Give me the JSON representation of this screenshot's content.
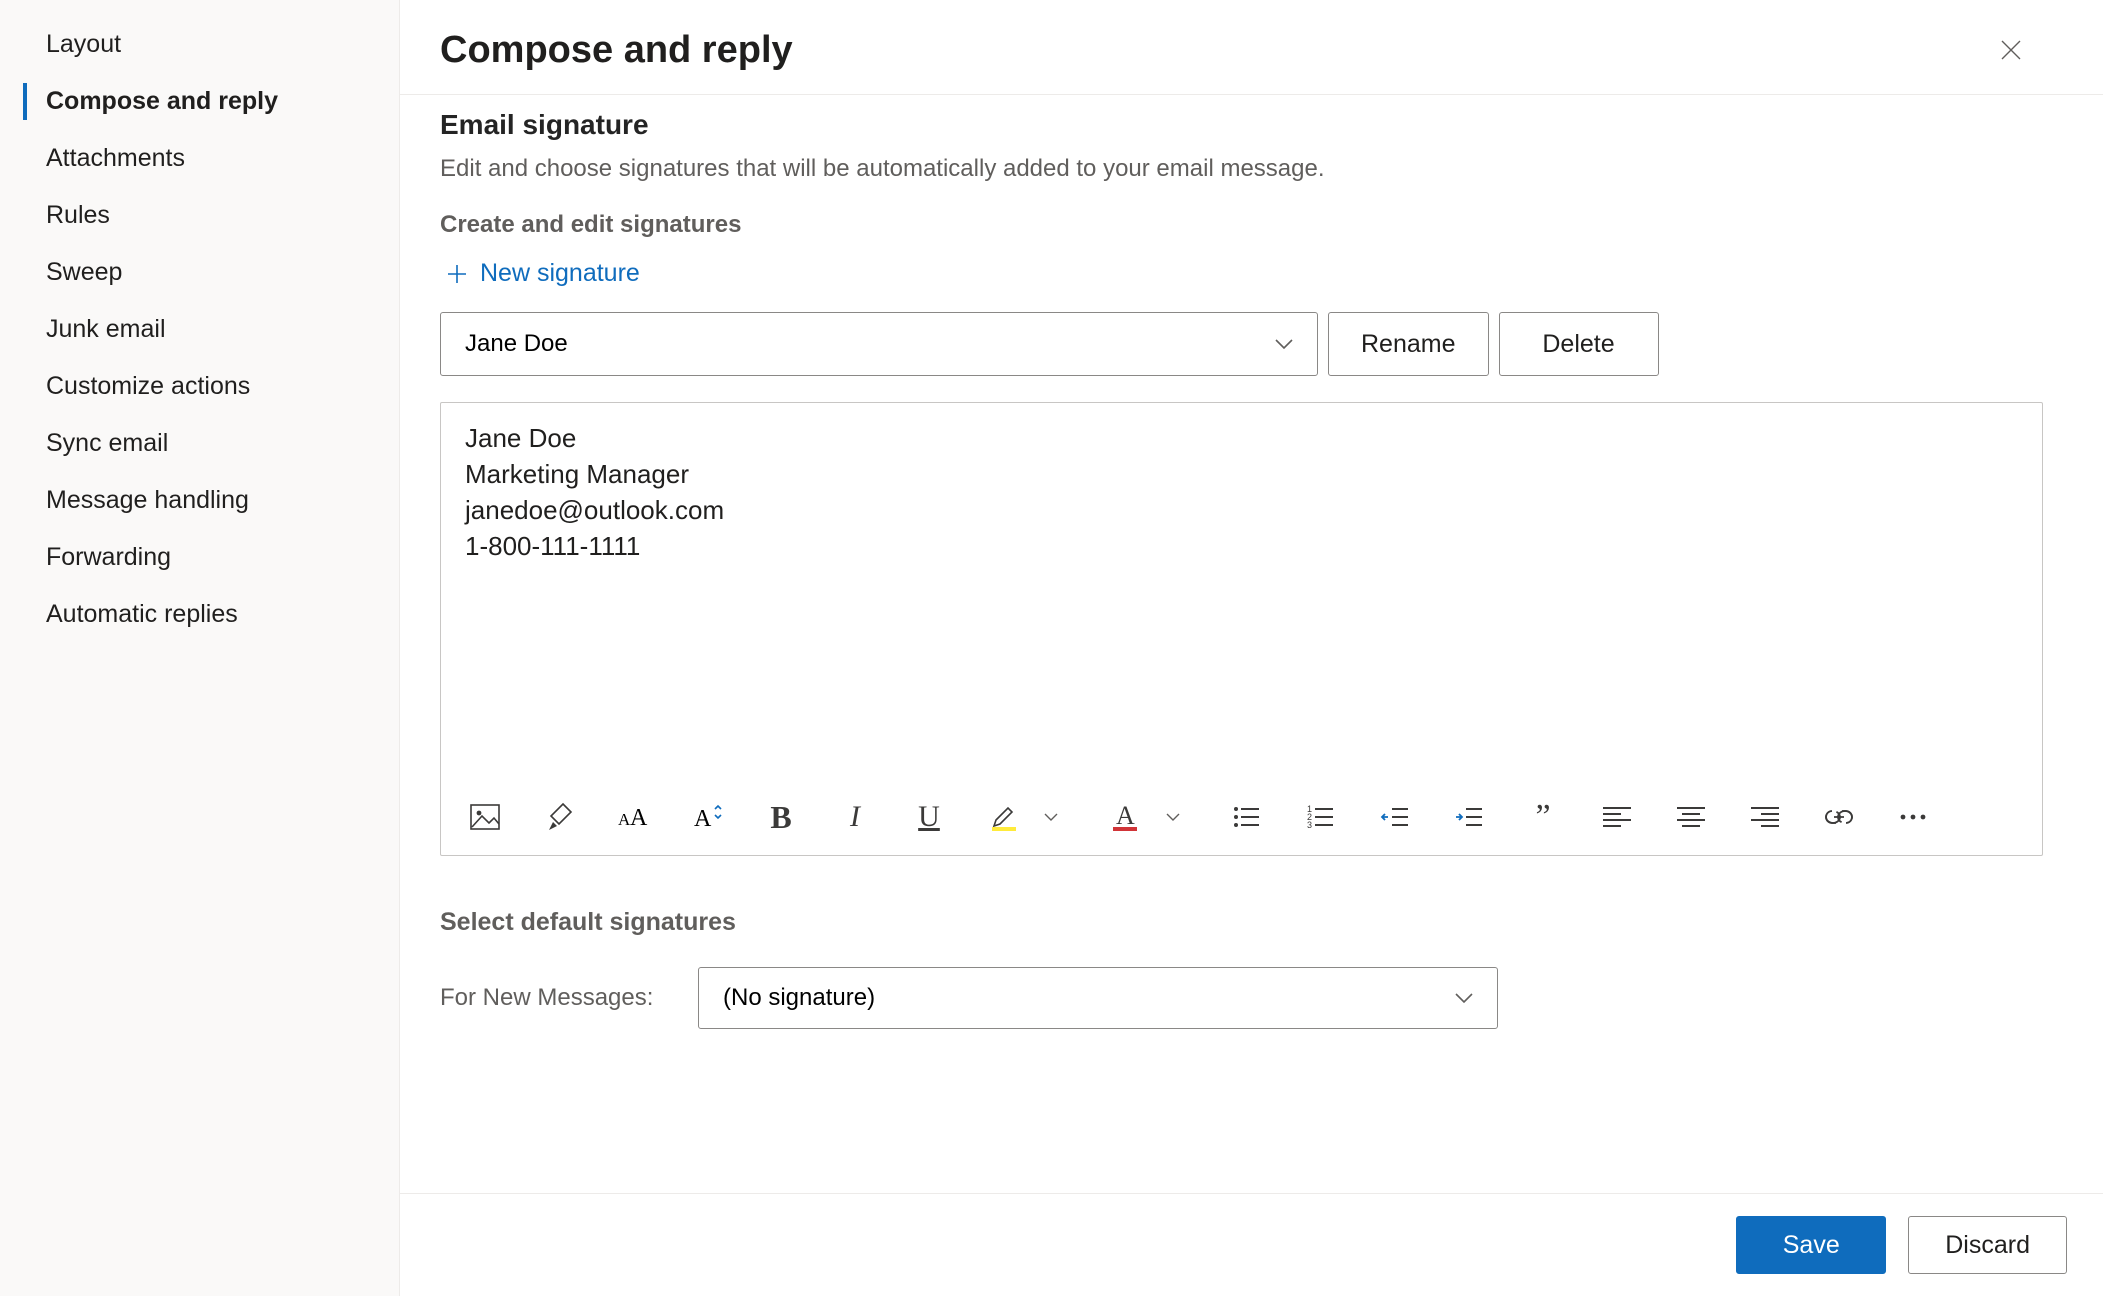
{
  "sidebar": {
    "items": [
      {
        "label": "Layout",
        "selected": false
      },
      {
        "label": "Compose and reply",
        "selected": true
      },
      {
        "label": "Attachments",
        "selected": false
      },
      {
        "label": "Rules",
        "selected": false
      },
      {
        "label": "Sweep",
        "selected": false
      },
      {
        "label": "Junk email",
        "selected": false
      },
      {
        "label": "Customize actions",
        "selected": false
      },
      {
        "label": "Sync email",
        "selected": false
      },
      {
        "label": "Message handling",
        "selected": false
      },
      {
        "label": "Forwarding",
        "selected": false
      },
      {
        "label": "Automatic replies",
        "selected": false
      }
    ]
  },
  "header": {
    "title": "Compose and reply"
  },
  "signature": {
    "section_title": "Email signature",
    "description": "Edit and choose signatures that will be automatically added to your email message.",
    "create_label": "Create and edit signatures",
    "new_link": "New signature",
    "selected_signature": "Jane Doe",
    "rename_label": "Rename",
    "delete_label": "Delete",
    "editor_lines": {
      "l1": "Jane Doe",
      "l2": "Marketing Manager",
      "l3": "janedoe@outlook.com",
      "l4": "1-800-111-1111"
    }
  },
  "defaults": {
    "section_title": "Select default signatures",
    "new_messages_label": "For New Messages:",
    "new_messages_value": "(No signature)"
  },
  "footer": {
    "save": "Save",
    "discard": "Discard"
  }
}
